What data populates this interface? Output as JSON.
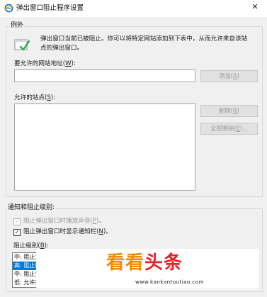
{
  "window": {
    "title": "弹出窗口阻止程序设置",
    "close_glyph": "✕"
  },
  "exceptions": {
    "legend": "例外",
    "info": "弹出窗口当前已被阻止。你可以将特定网站添加到下表中，从而允许来自该站点的弹出窗口。",
    "address_label_main": "要允许的网站地址",
    "address_label_key": "W",
    "address_value": "",
    "add_button_main": "添加",
    "add_button_key": "A",
    "allowed_label_main": "允许的站点",
    "allowed_label_key": "S",
    "allowed_sites": [],
    "remove_button_main": "删除",
    "remove_button_key": "R",
    "remove_all_button_main": "全部删除",
    "remove_all_button_key": "E"
  },
  "notifications": {
    "legend": "通知和阻止级别:",
    "play_sound_main": "阻止弹出窗口时播放声音",
    "play_sound_key": "P",
    "play_sound_checked": true,
    "play_sound_enabled": false,
    "show_bar_main": "阻止弹出窗口时显示通知栏",
    "show_bar_key": "N",
    "show_bar_checked": true,
    "show_bar_enabled": true,
    "level_label_main": "阻止级别",
    "level_label_key": "B",
    "level_options": [
      {
        "label": "中: 阻止大多",
        "selected": false
      },
      {
        "label": "高: 阻止所有",
        "selected": true
      },
      {
        "label": "中: 阻止大多",
        "selected": false
      },
      {
        "label": "低: 允许来自",
        "selected": false
      }
    ]
  },
  "watermark": {
    "logo_part1": "看看",
    "logo_part2": "头条",
    "url": "www.kankantoutiao.com",
    "color_orange": "#f08a00",
    "color_red": "#e6232b"
  },
  "colors": {
    "accent": "#0078d7",
    "window_bg": "#f0f0f0",
    "icon_green": "#2fa84f"
  }
}
